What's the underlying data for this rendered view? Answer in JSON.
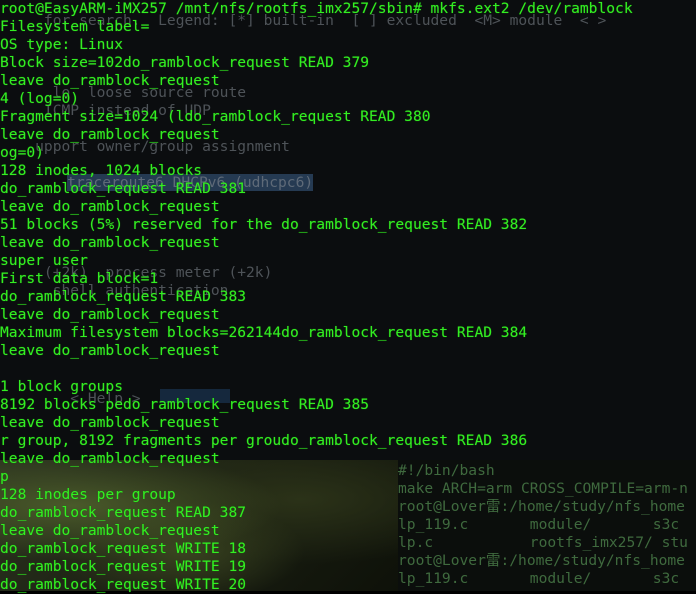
{
  "background_terminal": {
    "lines": [
      "     for search.  Legend: [*] built-in  [ ] excluded  <M> module  < >",
      "",
      "",
      "",
      "",
      "      lo  loose source route",
      "     ICMP instead of UDP",
      "",
      "    upport owner/group assignment",
      "    traceroute6 DHCPv6 (udhcpc6)",
      "",
      "",
      "",
      "",
      "",
      "",
      "",
      "",
      "     (+2k)  process meter (+2k)",
      "      shell authentication",
      "",
      "",
      "",
      "",
      "",
      "",
      "",
      "        < Help >"
    ],
    "highlight_text": "traceroute6 DHCPv6 (udhcpc6)"
  },
  "bottom_terminal": {
    "lines": [
      "#!/bin/bash",
      "make ARCH=arm CROSS_COMPILE=arm-n",
      "root@Lover雷:/home/study/nfs_home",
      "lp_119.c       module/       s3c",
      "lp.c           rootfs_imx257/ stu",
      "root@Lover雷:/home/study/nfs_home",
      "lp_119.c       module/       s3c"
    ]
  },
  "terminal": {
    "lines": [
      "root@EasyARM-iMX257 /mnt/nfs/rootfs_imx257/sbin# mkfs.ext2 /dev/ramblock",
      "Filesystem label=",
      "OS type: Linux",
      "Block size=102do_ramblock_request READ 379",
      "leave do_ramblock_request",
      "4 (log=0)",
      "Fragment size=1024 (ldo_ramblock_request READ 380",
      "leave do_ramblock_request",
      "og=0)",
      "128 inodes, 1024 blocks",
      "do_ramblock_request READ 381",
      "leave do_ramblock_request",
      "51 blocks (5%) reserved for the do_ramblock_request READ 382",
      "leave do_ramblock_request",
      "super user",
      "First data block=1",
      "do_ramblock_request READ 383",
      "leave do_ramblock_request",
      "Maximum filesystem blocks=262144do_ramblock_request READ 384",
      "leave do_ramblock_request",
      "",
      "1 block groups",
      "8192 blocks pedo_ramblock_request READ 385",
      "leave do_ramblock_request",
      "r group, 8192 fragments per groudo_ramblock_request READ 386",
      "leave do_ramblock_request",
      "p",
      "128 inodes per group",
      "do_ramblock_request READ 387",
      "leave do_ramblock_request",
      "do_ramblock_request WRITE 18",
      "do_ramblock_request WRITE 19",
      "do_ramblock_request WRITE 20"
    ]
  },
  "colors": {
    "terminal_text": "#33ee22",
    "ghost_text": "#4e5358",
    "background": "#000000"
  }
}
